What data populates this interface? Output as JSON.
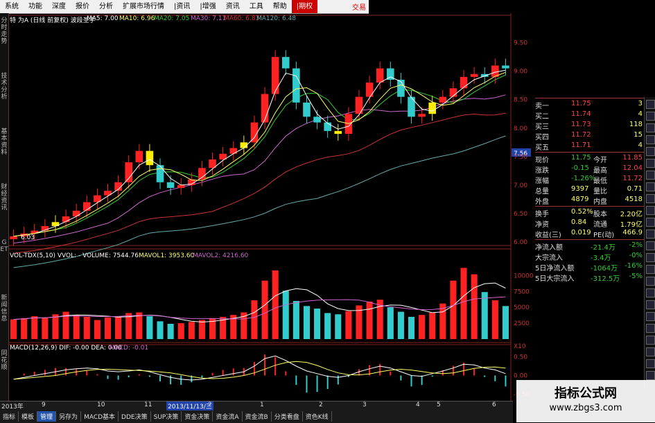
{
  "menu": {
    "items": [
      "系统",
      "功能",
      "深度",
      "报价",
      "分析",
      "扩展市场行情",
      "|资讯",
      "|增强",
      "资讯",
      "工具",
      "帮助",
      "|期权"
    ],
    "trade_label": "交易"
  },
  "left_tabs": [
    "分时走势",
    "技术分析",
    "基本资料",
    "财经资讯",
    "GET",
    "新闻信息",
    "同花顺"
  ],
  "price_header": {
    "title": "特 为A (日线 前复权) 波段圣手",
    "ma5": "MA5: 7.00",
    "ma10": "MA10: 6.96",
    "ma20": "MA20: 7.05",
    "ma30": "MA30: 7.11",
    "ma60": "MA60: 6.83",
    "ma120": "MA120: 6.48"
  },
  "vol_header": {
    "title": "VOL-TDX(5,10)  VVOL: -  VOLUME: 7544.76",
    "mavol1": "MAVOL1: 3953.60",
    "mavol2": "MAVOL2: 4216.60"
  },
  "macd_header": {
    "title": "MACD(12,26,9)  DIF: -0.00  DEA: 0.00",
    "macd": "MACD: -0.01"
  },
  "price_axis": [
    "9.50",
    "9.00",
    "8.50",
    "8.00",
    "7.56",
    "7.50",
    "7.00",
    "6.50",
    "6.00"
  ],
  "vol_axis": [
    "10000",
    "7500",
    "5000",
    "2500",
    "X10"
  ],
  "macd_axis": [
    "0.50",
    "0.00",
    "-0.50"
  ],
  "low_label": "6.03",
  "date_axis": [
    "2013年",
    "9",
    "10",
    "11",
    "2013/11/13/三",
    "2",
    "1",
    "2",
    "3",
    "4",
    "5",
    "6"
  ],
  "bottom_tabs": [
    "指标",
    "模板",
    "管理",
    "另存为",
    "MACD基本",
    "DDE决策",
    "SUP决策",
    "资金决策",
    "资金流A",
    "资金流B",
    "分类看盘",
    "资色K线"
  ],
  "quote": {
    "rows": [
      {
        "k": "卖一",
        "v": "11.75",
        "n": "3"
      },
      {
        "k": "买二",
        "v": "11.74",
        "n": "4"
      },
      {
        "k": "买三",
        "v": "11.73",
        "n": "118"
      },
      {
        "k": "买四",
        "v": "11.72",
        "n": "15"
      },
      {
        "k": "买五",
        "v": "11.71",
        "n": "4"
      }
    ],
    "stats": [
      {
        "k": "现价",
        "v": "11.75",
        "k2": "今开",
        "v2": "11.85"
      },
      {
        "k": "涨跌",
        "v": "-0.15",
        "k2": "最高",
        "v2": "12.04"
      },
      {
        "k": "涨幅",
        "v": "-1.26%",
        "k2": "最低",
        "v2": "11.72"
      },
      {
        "k": "总量",
        "v": "9397",
        "k2": "量比",
        "v2": "0.71"
      },
      {
        "k": "外盘",
        "v": "4879",
        "k2": "内盘",
        "v2": "4518"
      },
      {
        "k": "换手",
        "v": "0.52%",
        "k2": "股本",
        "v2": "2.20亿"
      },
      {
        "k": "净资",
        "v": "0.84",
        "k2": "流通",
        "v2": "1.79亿"
      },
      {
        "k": "收益(三)",
        "v": "0.019",
        "k2": "PE(动)",
        "v2": "466.9"
      }
    ],
    "flows": [
      {
        "k": "净流入额",
        "v": "-21.4万",
        "p": "-2%"
      },
      {
        "k": "大宗流入",
        "v": "-3.4万",
        "p": "-0%"
      },
      {
        "k": "5日净流入额",
        "v": "-1064万",
        "p": "-16%"
      },
      {
        "k": "5日大宗流入",
        "v": "-312.5万",
        "p": "-5%"
      }
    ],
    "price_top_partial": "9.50"
  },
  "watermark": {
    "line1": "指标公式网",
    "line2": "www.zbgs3.com"
  },
  "colors": {
    "up": "#ff2222",
    "down": "#33cccc",
    "yellow": "#ffee00",
    "ma5": "#ffffff",
    "ma10": "#ffff66",
    "ma20": "#33cc33",
    "ma30": "#cc66cc",
    "ma60": "#cc3333",
    "ma120": "#66aaaa",
    "grid": "#661111"
  },
  "chart_data": {
    "type": "candlestick",
    "price_ylim": [
      6.0,
      9.8
    ],
    "closes": [
      6.1,
      6.15,
      6.2,
      6.28,
      6.35,
      6.45,
      6.55,
      6.7,
      6.82,
      6.9,
      7.05,
      7.4,
      7.6,
      7.35,
      7.05,
      6.95,
      7.0,
      7.1,
      7.3,
      7.45,
      7.55,
      7.65,
      7.75,
      8.1,
      8.6,
      9.25,
      9.05,
      8.45,
      8.2,
      8.1,
      7.95,
      7.9,
      8.25,
      8.55,
      8.8,
      9.05,
      8.85,
      8.55,
      8.2,
      8.25,
      8.45,
      8.55,
      8.7,
      8.9,
      8.95,
      8.9,
      9.1,
      9.05
    ],
    "vol_ylim": [
      0,
      12000
    ],
    "volumes": [
      3100,
      3300,
      3600,
      3400,
      3900,
      4300,
      3800,
      3500,
      3000,
      3400,
      3600,
      4100,
      4200,
      3600,
      2800,
      2400,
      2500,
      2700,
      3000,
      3300,
      3500,
      3800,
      4200,
      6100,
      9200,
      10800,
      7600,
      6000,
      5200,
      4800,
      4100,
      3900,
      4400,
      5300,
      5900,
      6200,
      5000,
      4300,
      3500,
      3800,
      4200,
      5600,
      9200,
      11200,
      10200,
      7400,
      6100,
      5200
    ],
    "macd_ylim": [
      -0.6,
      0.6
    ],
    "dif": [
      -0.1,
      -0.05,
      0.0,
      0.05,
      0.1,
      0.15,
      0.18,
      0.2,
      0.18,
      0.12,
      0.1,
      0.12,
      0.15,
      0.1,
      0.02,
      -0.05,
      -0.1,
      -0.12,
      -0.1,
      -0.05,
      0.0,
      0.05,
      0.1,
      0.25,
      0.45,
      0.52,
      0.4,
      0.25,
      0.12,
      0.05,
      -0.02,
      -0.05,
      0.0,
      0.1,
      0.18,
      0.25,
      0.2,
      0.1,
      0.0,
      -0.02,
      0.05,
      0.12,
      0.2,
      0.3,
      0.28,
      0.2,
      0.15,
      0.05
    ]
  }
}
